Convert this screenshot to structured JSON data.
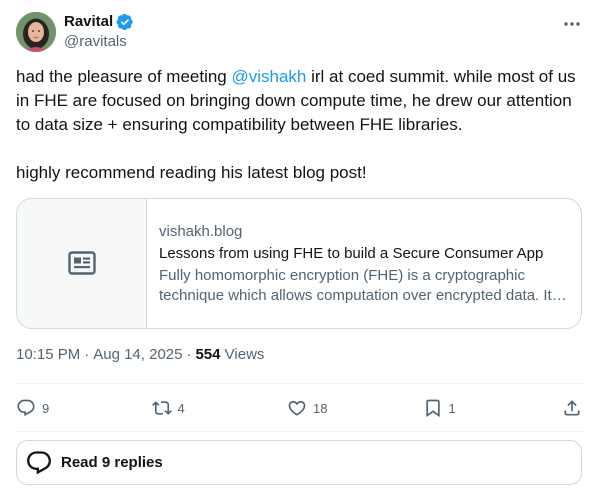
{
  "author": {
    "display_name": "Ravital",
    "handle": "@ravitals",
    "verified": true,
    "verified_color": "#1d9bf0"
  },
  "tweet": {
    "text_before_mention": "had the pleasure of meeting ",
    "mention": "@vishakh",
    "text_after_mention": " irl at coed summit. while most of us in FHE are focused on bringing down compute time, he drew our attention to data size + ensuring compatibility between FHE libraries.",
    "paragraph2": "highly recommend reading his latest blog post!"
  },
  "card": {
    "domain": "vishakh.blog",
    "title": "Lessons from using FHE to build a Secure Consumer App",
    "description": "Fully homomorphic encryption (FHE) is a cryptographic technique which allows computation over encrypted data. It is useful for building secure consumer applications.",
    "icon": "article-icon"
  },
  "meta": {
    "time": "10:15 PM",
    "date": "Aug 14, 2025",
    "separator": "·",
    "views_count": "554",
    "views_label": "Views"
  },
  "actions": {
    "replies": "9",
    "reposts": "4",
    "likes": "18",
    "bookmarks": "1"
  },
  "read_replies_label": "Read 9 replies",
  "colors": {
    "accent": "#1d9bf0",
    "text": "#0f1419",
    "secondary": "#536471",
    "border": "#cfd9de"
  }
}
